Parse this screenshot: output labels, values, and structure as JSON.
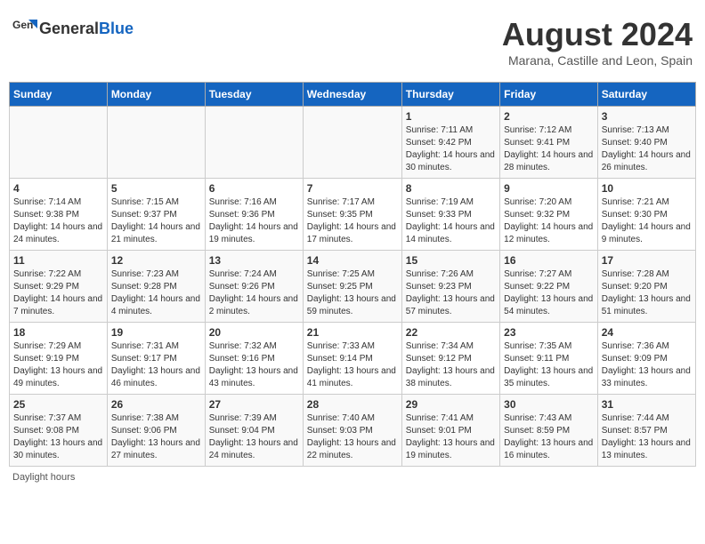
{
  "header": {
    "logo_general": "General",
    "logo_blue": "Blue",
    "title": "August 2024",
    "subtitle": "Marana, Castille and Leon, Spain"
  },
  "days_of_week": [
    "Sunday",
    "Monday",
    "Tuesday",
    "Wednesday",
    "Thursday",
    "Friday",
    "Saturday"
  ],
  "weeks": [
    [
      {
        "day": "",
        "sunrise": "",
        "sunset": "",
        "daylight": ""
      },
      {
        "day": "",
        "sunrise": "",
        "sunset": "",
        "daylight": ""
      },
      {
        "day": "",
        "sunrise": "",
        "sunset": "",
        "daylight": ""
      },
      {
        "day": "",
        "sunrise": "",
        "sunset": "",
        "daylight": ""
      },
      {
        "day": "1",
        "sunrise": "Sunrise: 7:11 AM",
        "sunset": "Sunset: 9:42 PM",
        "daylight": "Daylight: 14 hours and 30 minutes."
      },
      {
        "day": "2",
        "sunrise": "Sunrise: 7:12 AM",
        "sunset": "Sunset: 9:41 PM",
        "daylight": "Daylight: 14 hours and 28 minutes."
      },
      {
        "day": "3",
        "sunrise": "Sunrise: 7:13 AM",
        "sunset": "Sunset: 9:40 PM",
        "daylight": "Daylight: 14 hours and 26 minutes."
      }
    ],
    [
      {
        "day": "4",
        "sunrise": "Sunrise: 7:14 AM",
        "sunset": "Sunset: 9:38 PM",
        "daylight": "Daylight: 14 hours and 24 minutes."
      },
      {
        "day": "5",
        "sunrise": "Sunrise: 7:15 AM",
        "sunset": "Sunset: 9:37 PM",
        "daylight": "Daylight: 14 hours and 21 minutes."
      },
      {
        "day": "6",
        "sunrise": "Sunrise: 7:16 AM",
        "sunset": "Sunset: 9:36 PM",
        "daylight": "Daylight: 14 hours and 19 minutes."
      },
      {
        "day": "7",
        "sunrise": "Sunrise: 7:17 AM",
        "sunset": "Sunset: 9:35 PM",
        "daylight": "Daylight: 14 hours and 17 minutes."
      },
      {
        "day": "8",
        "sunrise": "Sunrise: 7:19 AM",
        "sunset": "Sunset: 9:33 PM",
        "daylight": "Daylight: 14 hours and 14 minutes."
      },
      {
        "day": "9",
        "sunrise": "Sunrise: 7:20 AM",
        "sunset": "Sunset: 9:32 PM",
        "daylight": "Daylight: 14 hours and 12 minutes."
      },
      {
        "day": "10",
        "sunrise": "Sunrise: 7:21 AM",
        "sunset": "Sunset: 9:30 PM",
        "daylight": "Daylight: 14 hours and 9 minutes."
      }
    ],
    [
      {
        "day": "11",
        "sunrise": "Sunrise: 7:22 AM",
        "sunset": "Sunset: 9:29 PM",
        "daylight": "Daylight: 14 hours and 7 minutes."
      },
      {
        "day": "12",
        "sunrise": "Sunrise: 7:23 AM",
        "sunset": "Sunset: 9:28 PM",
        "daylight": "Daylight: 14 hours and 4 minutes."
      },
      {
        "day": "13",
        "sunrise": "Sunrise: 7:24 AM",
        "sunset": "Sunset: 9:26 PM",
        "daylight": "Daylight: 14 hours and 2 minutes."
      },
      {
        "day": "14",
        "sunrise": "Sunrise: 7:25 AM",
        "sunset": "Sunset: 9:25 PM",
        "daylight": "Daylight: 13 hours and 59 minutes."
      },
      {
        "day": "15",
        "sunrise": "Sunrise: 7:26 AM",
        "sunset": "Sunset: 9:23 PM",
        "daylight": "Daylight: 13 hours and 57 minutes."
      },
      {
        "day": "16",
        "sunrise": "Sunrise: 7:27 AM",
        "sunset": "Sunset: 9:22 PM",
        "daylight": "Daylight: 13 hours and 54 minutes."
      },
      {
        "day": "17",
        "sunrise": "Sunrise: 7:28 AM",
        "sunset": "Sunset: 9:20 PM",
        "daylight": "Daylight: 13 hours and 51 minutes."
      }
    ],
    [
      {
        "day": "18",
        "sunrise": "Sunrise: 7:29 AM",
        "sunset": "Sunset: 9:19 PM",
        "daylight": "Daylight: 13 hours and 49 minutes."
      },
      {
        "day": "19",
        "sunrise": "Sunrise: 7:31 AM",
        "sunset": "Sunset: 9:17 PM",
        "daylight": "Daylight: 13 hours and 46 minutes."
      },
      {
        "day": "20",
        "sunrise": "Sunrise: 7:32 AM",
        "sunset": "Sunset: 9:16 PM",
        "daylight": "Daylight: 13 hours and 43 minutes."
      },
      {
        "day": "21",
        "sunrise": "Sunrise: 7:33 AM",
        "sunset": "Sunset: 9:14 PM",
        "daylight": "Daylight: 13 hours and 41 minutes."
      },
      {
        "day": "22",
        "sunrise": "Sunrise: 7:34 AM",
        "sunset": "Sunset: 9:12 PM",
        "daylight": "Daylight: 13 hours and 38 minutes."
      },
      {
        "day": "23",
        "sunrise": "Sunrise: 7:35 AM",
        "sunset": "Sunset: 9:11 PM",
        "daylight": "Daylight: 13 hours and 35 minutes."
      },
      {
        "day": "24",
        "sunrise": "Sunrise: 7:36 AM",
        "sunset": "Sunset: 9:09 PM",
        "daylight": "Daylight: 13 hours and 33 minutes."
      }
    ],
    [
      {
        "day": "25",
        "sunrise": "Sunrise: 7:37 AM",
        "sunset": "Sunset: 9:08 PM",
        "daylight": "Daylight: 13 hours and 30 minutes."
      },
      {
        "day": "26",
        "sunrise": "Sunrise: 7:38 AM",
        "sunset": "Sunset: 9:06 PM",
        "daylight": "Daylight: 13 hours and 27 minutes."
      },
      {
        "day": "27",
        "sunrise": "Sunrise: 7:39 AM",
        "sunset": "Sunset: 9:04 PM",
        "daylight": "Daylight: 13 hours and 24 minutes."
      },
      {
        "day": "28",
        "sunrise": "Sunrise: 7:40 AM",
        "sunset": "Sunset: 9:03 PM",
        "daylight": "Daylight: 13 hours and 22 minutes."
      },
      {
        "day": "29",
        "sunrise": "Sunrise: 7:41 AM",
        "sunset": "Sunset: 9:01 PM",
        "daylight": "Daylight: 13 hours and 19 minutes."
      },
      {
        "day": "30",
        "sunrise": "Sunrise: 7:43 AM",
        "sunset": "Sunset: 8:59 PM",
        "daylight": "Daylight: 13 hours and 16 minutes."
      },
      {
        "day": "31",
        "sunrise": "Sunrise: 7:44 AM",
        "sunset": "Sunset: 8:57 PM",
        "daylight": "Daylight: 13 hours and 13 minutes."
      }
    ]
  ],
  "footer": "Daylight hours"
}
